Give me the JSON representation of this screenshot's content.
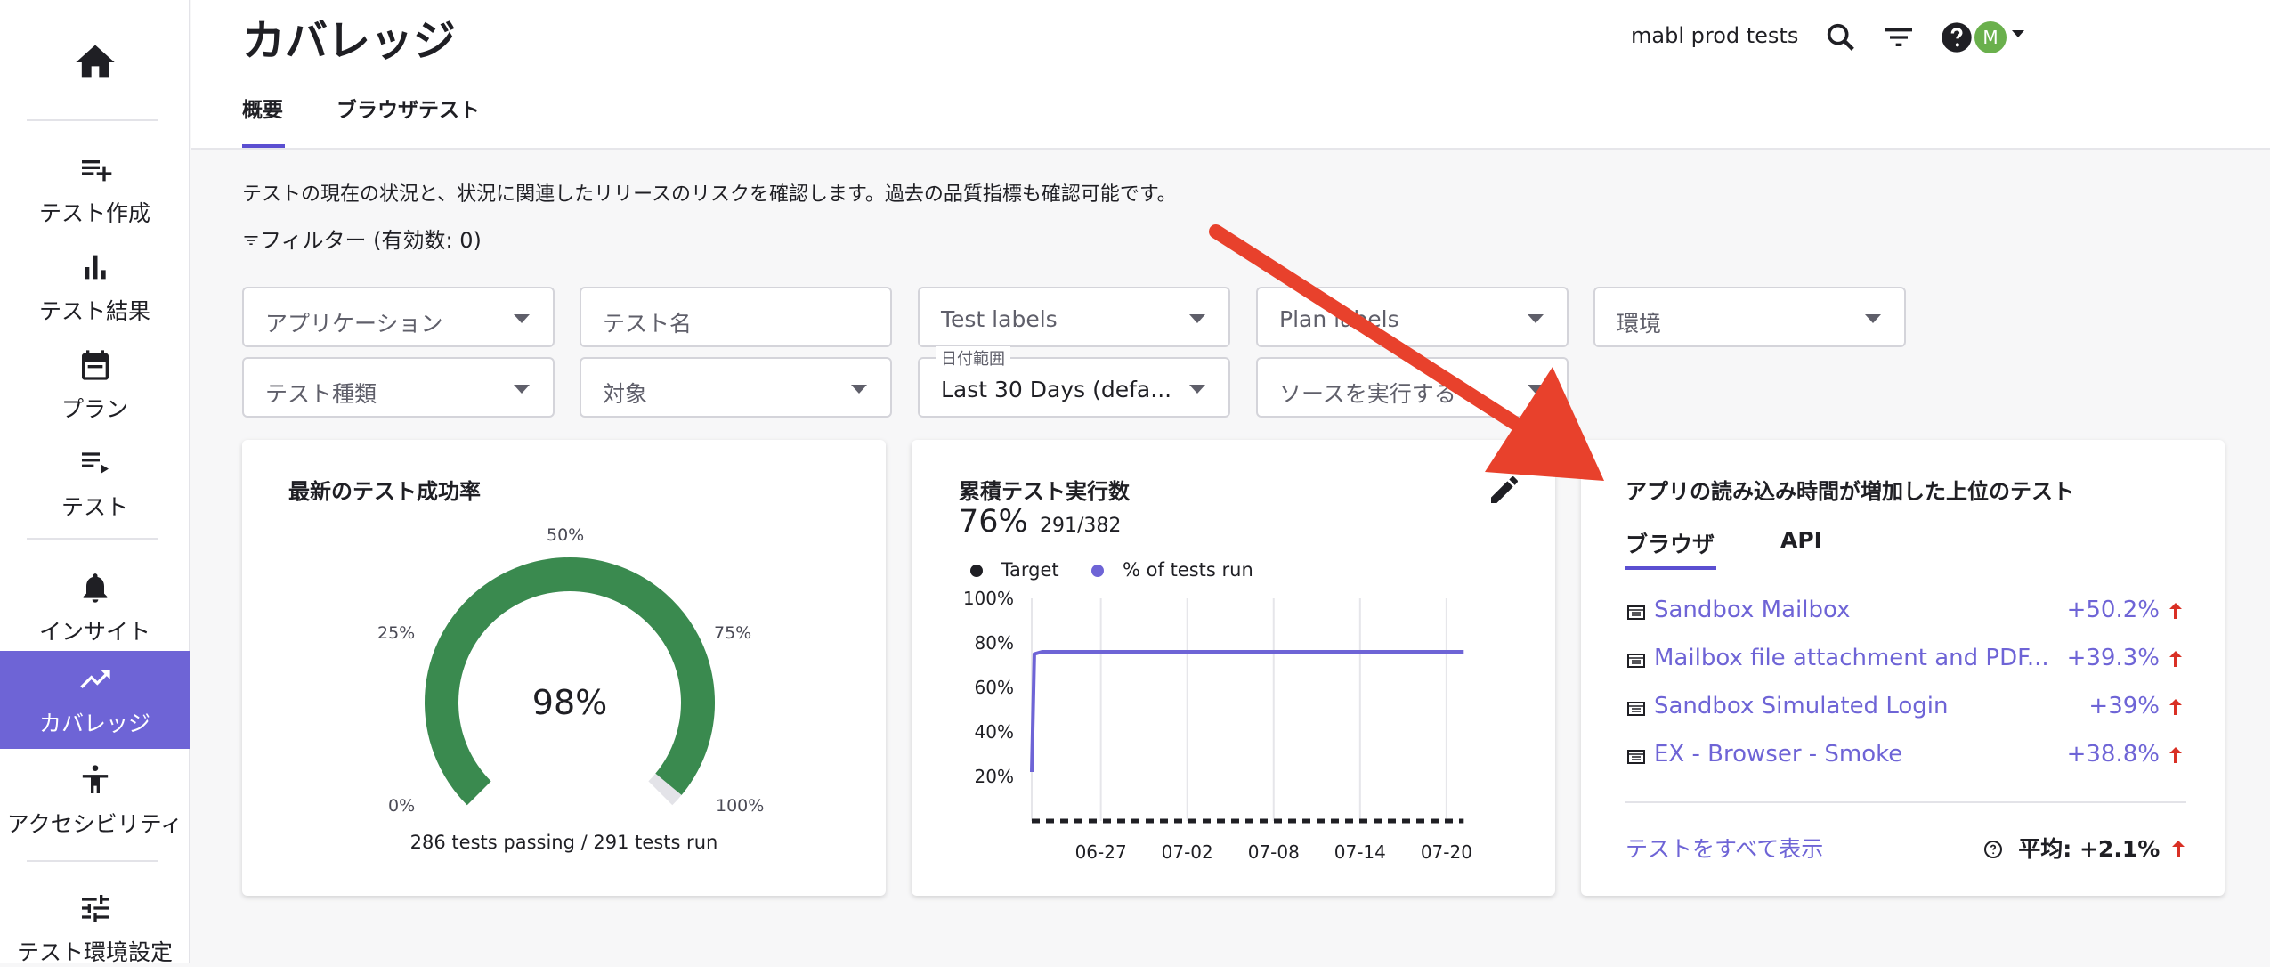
{
  "sidebar": {
    "home_icon": "home-icon",
    "items": [
      {
        "label": "テスト作成",
        "icon": "playlist-add-icon"
      },
      {
        "label": "テスト結果",
        "icon": "bar-chart-icon"
      },
      {
        "label": "プラン",
        "icon": "calendar-icon"
      },
      {
        "label": "テスト",
        "icon": "list-play-icon"
      },
      {
        "label": "インサイト",
        "icon": "bell-icon"
      },
      {
        "label": "カバレッジ",
        "icon": "trending-up-icon",
        "active": true
      },
      {
        "label": "アクセシビリティ",
        "icon": "accessibility-icon"
      },
      {
        "label": "テスト環境設定",
        "icon": "tune-icon"
      }
    ]
  },
  "header": {
    "title": "カバレッジ",
    "tabs": [
      {
        "label": "概要",
        "active": true
      },
      {
        "label": "ブラウザテスト"
      }
    ],
    "user": "mabl prod tests",
    "avatar_initial": "M"
  },
  "main": {
    "description": "テストの現在の状況と、状況に関連したリリースのリスクを確認します。過去の品質指標も確認可能です。",
    "filter_label": "フィルター (有効数: 0)",
    "filters": [
      {
        "value": "アプリケーション"
      },
      {
        "value": "テスト名"
      },
      {
        "value": "Test labels"
      },
      {
        "value": "Plan labels"
      },
      {
        "value": "環境"
      },
      {
        "value": "テスト種類"
      },
      {
        "value": "対象"
      },
      {
        "value": "Last 30 Days (defa...",
        "label": "日付範囲"
      },
      {
        "value": "ソースを実行する"
      }
    ]
  },
  "cards": {
    "pass_rate": {
      "title": "最新のテスト成功率",
      "value_text": "98%",
      "value": 98,
      "ticks": [
        "0%",
        "25%",
        "50%",
        "75%",
        "100%"
      ],
      "caption": "286 tests passing / 291 tests run",
      "color": "#3a8a4f"
    },
    "cumulative": {
      "title": "累積テスト実行数",
      "percent": "76%",
      "ratio": "291/382",
      "legend": [
        {
          "label": "Target",
          "color": "#1f1f24"
        },
        {
          "label": "% of tests run",
          "color": "#6e64d6"
        }
      ]
    },
    "load_time": {
      "title": "アプリの読み込み時間が増加した上位のテスト",
      "tabs": [
        "ブラウザ",
        "API"
      ],
      "rows": [
        {
          "name": "Sandbox Mailbox",
          "delta": "+50.2%"
        },
        {
          "name": "Mailbox file attachment and PDF...",
          "delta": "+39.3%"
        },
        {
          "name": "Sandbox Simulated Login",
          "delta": "+39%"
        },
        {
          "name": "EX - Browser - Smoke",
          "delta": "+38.8%"
        }
      ],
      "view_all": "テストをすべて表示",
      "average": "平均: +2.1%"
    }
  },
  "chart_data": {
    "type": "line",
    "title": "累積テスト実行数",
    "xlabel": "",
    "ylabel": "",
    "x_ticks": [
      "06-27",
      "07-02",
      "07-08",
      "07-14",
      "07-20"
    ],
    "y_ticks": [
      "20%",
      "40%",
      "60%",
      "80%",
      "100%"
    ],
    "ylim": [
      0,
      100
    ],
    "grid": true,
    "legend_position": "top-left",
    "series": [
      {
        "name": "% of tests run",
        "color": "#6e64d6",
        "x_index": [
          0,
          0.15,
          0.6,
          1,
          2,
          3,
          4,
          5,
          6,
          7,
          8,
          9,
          10,
          11,
          12,
          13,
          14,
          15,
          16,
          17,
          18,
          19,
          20,
          21,
          22,
          23,
          24,
          25
        ],
        "values": [
          22,
          75,
          76,
          76,
          76,
          76,
          76,
          76,
          76,
          76,
          76,
          76,
          76,
          76,
          76,
          76,
          76,
          76,
          76,
          76,
          76,
          76,
          76,
          76,
          76,
          76,
          76,
          76
        ]
      },
      {
        "name": "Target",
        "color": "#1f1f24",
        "x_index": [
          0,
          25
        ],
        "values": [
          0,
          0
        ],
        "dashed": true
      }
    ],
    "x_tick_index": [
      4,
      9,
      14,
      19,
      24
    ],
    "x_max_index": 25.5
  }
}
